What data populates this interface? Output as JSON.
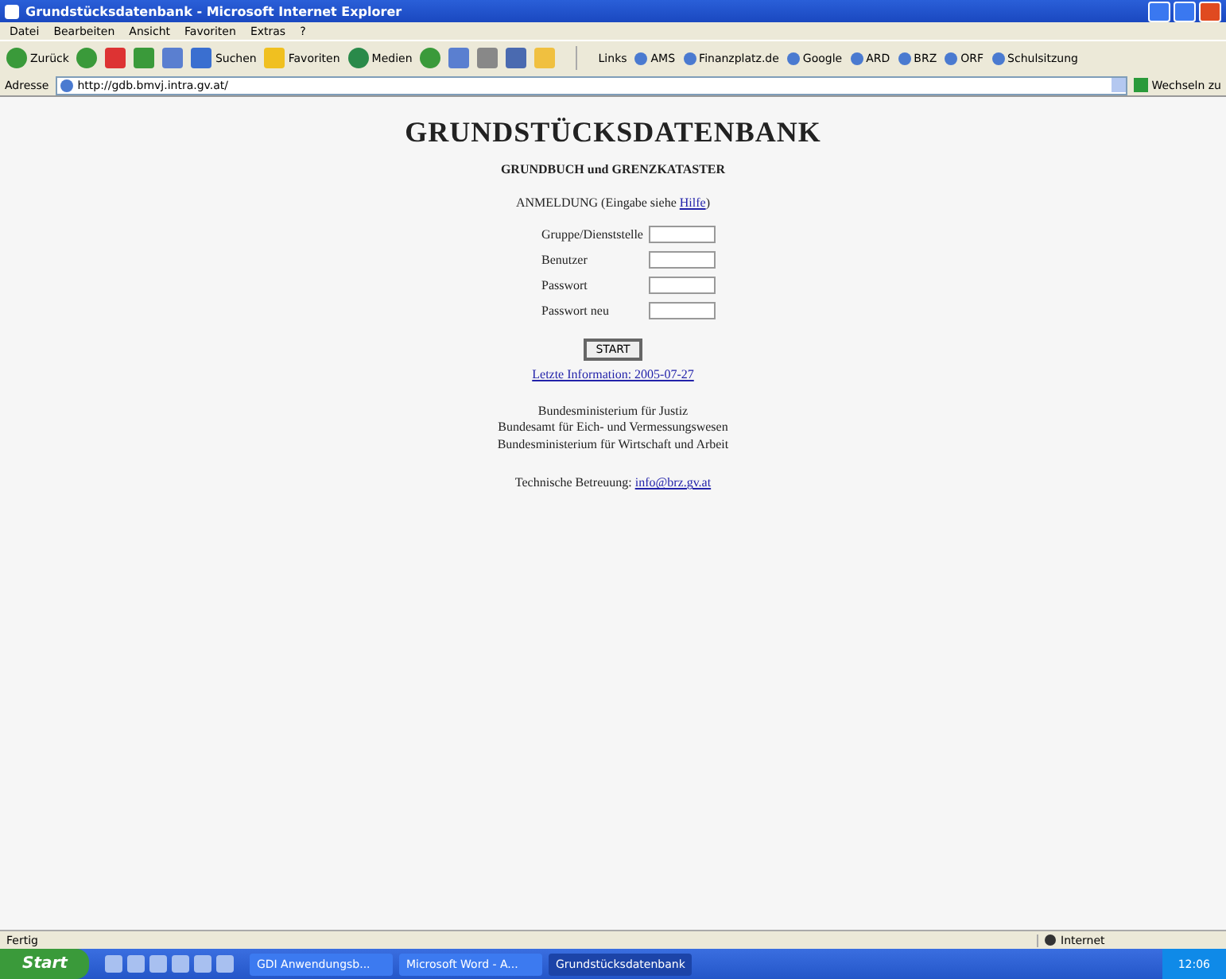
{
  "window": {
    "title": "Grundstücksdatenbank - Microsoft Internet Explorer"
  },
  "menu": [
    "Datei",
    "Bearbeiten",
    "Ansicht",
    "Favoriten",
    "Extras",
    "?"
  ],
  "toolbar": [
    {
      "kind": "back",
      "label": "Zurück"
    },
    {
      "kind": "forward"
    },
    {
      "kind": "stop"
    },
    {
      "kind": "refresh"
    },
    {
      "kind": "home"
    },
    {
      "kind": "search",
      "label": "Suchen"
    },
    {
      "kind": "favorites",
      "label": "Favoriten"
    },
    {
      "kind": "media",
      "label": "Medien"
    },
    {
      "kind": "history"
    },
    {
      "kind": "mail"
    },
    {
      "kind": "print"
    },
    {
      "kind": "edit"
    },
    {
      "kind": "folder"
    }
  ],
  "links": {
    "label": "Links",
    "items": [
      "AMS",
      "Finanzplatz.de",
      "Google",
      "ARD",
      "BRZ",
      "ORF",
      "Schulsitzung"
    ]
  },
  "address": {
    "label": "Adresse",
    "value": "http://gdb.bmvj.intra.gv.at/",
    "go": "Wechseln zu"
  },
  "page": {
    "heading": "GRUNDSTÜCKSDATENBANK",
    "subheading": "GRUNDBUCH und GRENZKATASTER",
    "login_text": "ANMELDUNG (Eingabe siehe ",
    "login_link": "Hilfe",
    "login_end": ")",
    "fields": [
      {
        "label": "Gruppe/Dienststelle"
      },
      {
        "label": "Benutzer"
      },
      {
        "label": "Passwort"
      },
      {
        "label": "Passwort neu"
      }
    ],
    "button": "START",
    "info_link": "Letzte Information: 2005-07-27",
    "ministries": [
      "Bundesministerium für Justiz",
      "Bundesamt für Eich- und Vermessungswesen",
      "Bundesministerium für Wirtschaft und Arbeit"
    ],
    "support_text": "Technische Betreuung: ",
    "support_link": "info@brz.gv.at"
  },
  "status_bar": {
    "text": "Fertig",
    "zone": "Internet"
  },
  "taskbar": {
    "start": "Start",
    "tasks": [
      {
        "label": "GDI Anwendungsb...",
        "selected": false
      },
      {
        "label": "Microsoft Word - A...",
        "selected": false
      },
      {
        "label": "Grundstücksdatenbank",
        "selected": true
      }
    ],
    "clock": "12:06"
  }
}
